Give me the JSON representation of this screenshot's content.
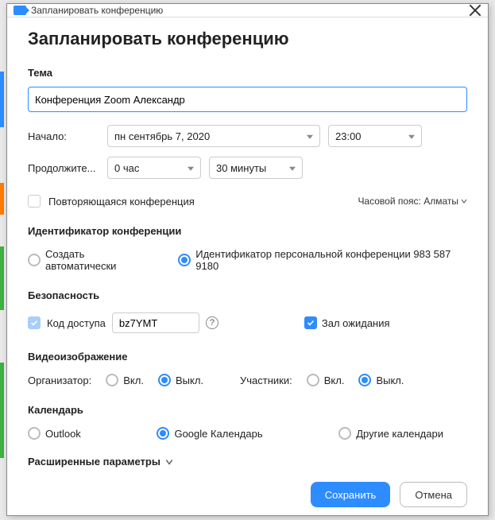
{
  "titlebar": {
    "text": "Запланировать конференцию"
  },
  "heading": "Запланировать конференцию",
  "topic": {
    "label": "Тема",
    "value": "Конференция Zoom Александр"
  },
  "start": {
    "label": "Начало:",
    "date": "пн   сентябрь 7, 2020",
    "time": "23:00"
  },
  "duration": {
    "label": "Продолжите...",
    "hours": "0 час",
    "minutes": "30 минуты"
  },
  "recurring": {
    "label": "Повторяющаяся конференция"
  },
  "timezone": {
    "label": "Часовой пояс: Алматы"
  },
  "meetingId": {
    "label": "Идентификатор конференции",
    "auto": "Создать автоматически",
    "personal": "Идентификатор персональной конференции 983 587 9180"
  },
  "security": {
    "label": "Безопасность",
    "codeLabel": "Код доступа",
    "codeValue": "bz7YMT",
    "waiting": "Зал ожидания"
  },
  "video": {
    "label": "Видеоизображение",
    "host": "Организатор:",
    "participants": "Участники:",
    "on": "Вкл.",
    "off": "Выкл."
  },
  "calendar": {
    "label": "Календарь",
    "outlook": "Outlook",
    "google": "Google Календарь",
    "other": "Другие календари"
  },
  "advanced": "Расширенные параметры",
  "buttons": {
    "save": "Сохранить",
    "cancel": "Отмена"
  }
}
